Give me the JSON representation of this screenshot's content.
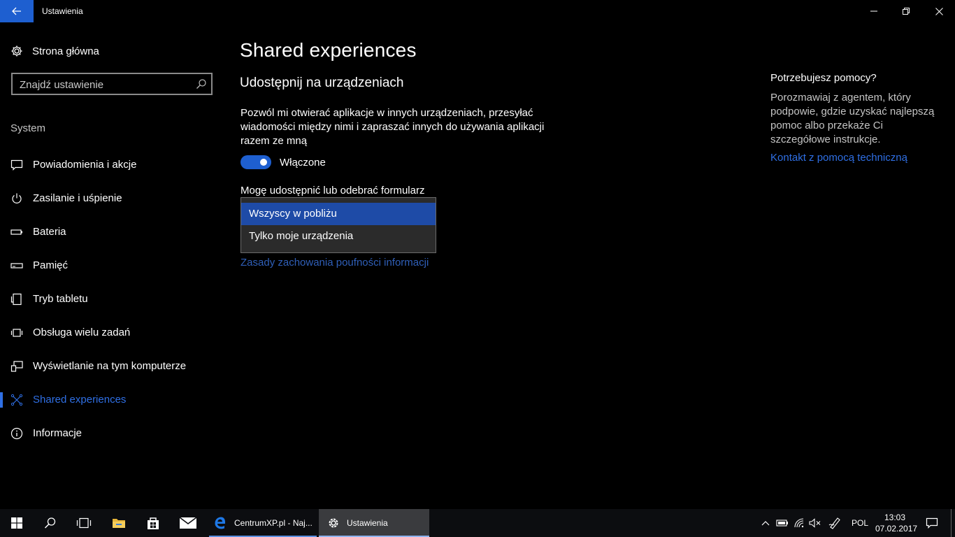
{
  "window": {
    "title": "Ustawienia"
  },
  "sidebar": {
    "home_label": "Strona główna",
    "search_placeholder": "Znajdź ustawienie",
    "section_label": "System",
    "items": [
      {
        "label": "Powiadomienia i akcje",
        "icon": "notification-icon"
      },
      {
        "label": "Zasilanie i uśpienie",
        "icon": "power-icon"
      },
      {
        "label": "Bateria",
        "icon": "battery-icon"
      },
      {
        "label": "Pamięć",
        "icon": "storage-icon"
      },
      {
        "label": "Tryb tabletu",
        "icon": "tablet-icon"
      },
      {
        "label": "Obsługa wielu zadań",
        "icon": "multitasking-icon"
      },
      {
        "label": "Wyświetlanie na tym komputerze",
        "icon": "projecting-icon"
      },
      {
        "label": "Shared experiences",
        "icon": "shared-experiences-icon",
        "active": true
      },
      {
        "label": "Informacje",
        "icon": "info-icon"
      }
    ]
  },
  "main": {
    "title": "Shared experiences",
    "section_title": "Udostępnij na urządzeniach",
    "description": "Pozwól mi otwierać aplikacje w innych urządzeniach, przesyłać wiadomości między nimi i zapraszać innych do używania aplikacji razem ze mną",
    "toggle_state": "Włączone",
    "dropdown_label": "Mogę udostępnić lub odebrać formularz",
    "dropdown_options": [
      "Wszyscy w pobliżu",
      "Tylko moje urządzenia"
    ],
    "dropdown_selected": "Wszyscy w pobliżu",
    "privacy_link": "Zasady zachowania poufności informacji"
  },
  "help": {
    "title": "Potrzebujesz pomocy?",
    "text": "Porozmawiaj z agentem, który podpowie, gdzie uzyskać najlepszą pomoc albo przekaże Ci szczegółowe instrukcje.",
    "link": "Kontakt z pomocą techniczną"
  },
  "taskbar": {
    "edge_label": "CentrumXP.pl - Naj...",
    "settings_label": "Ustawienia",
    "language": "POL",
    "time": "13:03",
    "date": "07.02.2017"
  },
  "colors": {
    "accent": "#1e5fd0",
    "link": "#2f6fe4",
    "background": "#000000"
  }
}
